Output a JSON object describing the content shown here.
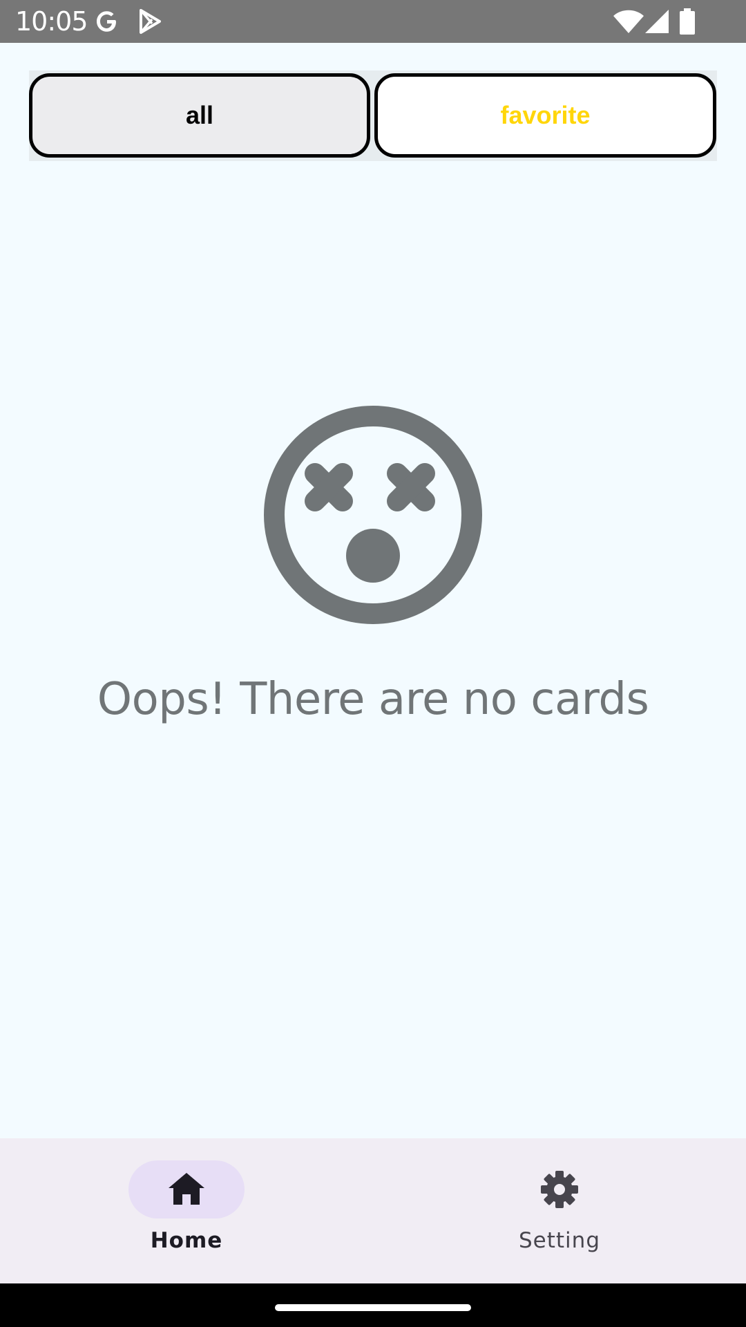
{
  "status_bar": {
    "time": "10:05",
    "icons": [
      "google-icon",
      "play-store-icon",
      "wifi-icon",
      "cell-signal-icon",
      "battery-icon"
    ]
  },
  "tabs": {
    "all_label": "all",
    "favorite_label": "favorite",
    "favorite_color": "#ffd60a"
  },
  "empty_state": {
    "icon": "dizzy-face-icon",
    "message": "Oops! There are no cards"
  },
  "bottom_nav": {
    "items": [
      {
        "label": "Home",
        "icon": "home-icon",
        "selected": true
      },
      {
        "label": "Setting",
        "icon": "gear-icon",
        "selected": false
      }
    ]
  },
  "colors": {
    "background": "#f3fbff",
    "icon_gray": "#707577",
    "nav_background": "#f1edf4",
    "nav_pill": "#e7def6"
  }
}
